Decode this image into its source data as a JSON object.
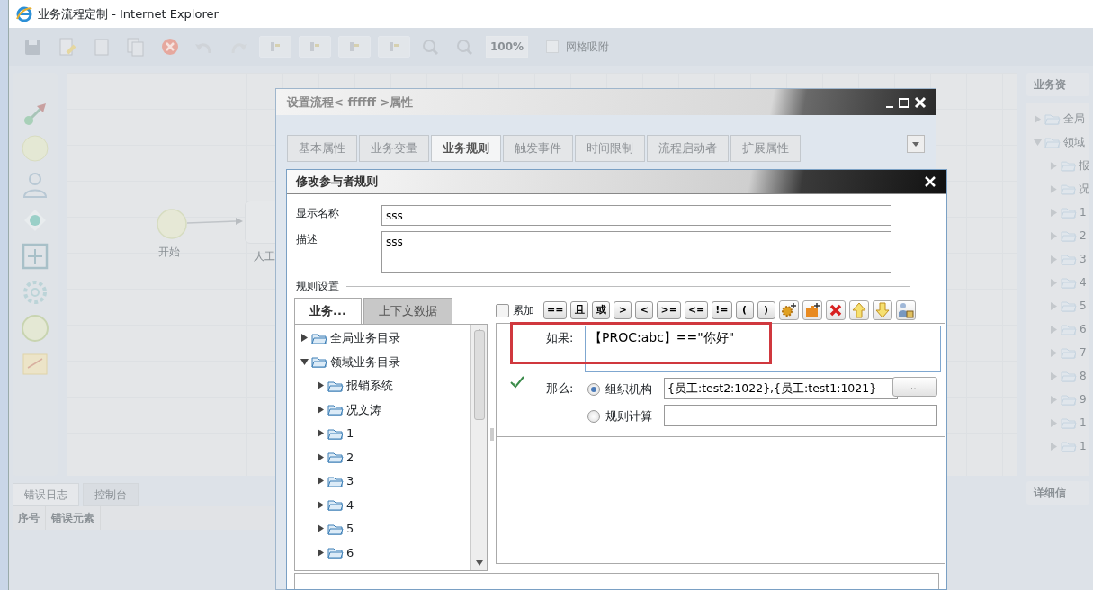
{
  "window": {
    "title": "业务流程定制 - Internet Explorer"
  },
  "toolbar": {
    "zoom": "100%",
    "grid": {
      "label": "网格吸附",
      "checked": false
    }
  },
  "canvas": {
    "nodes": [
      {
        "kind": "start",
        "label": "开始"
      },
      {
        "kind": "task",
        "label": "人工"
      }
    ]
  },
  "bottom_panel": {
    "tabs": [
      {
        "label": "错误日志",
        "selected": true
      },
      {
        "label": "控制台",
        "selected": false
      }
    ],
    "columns": [
      "序号",
      "错误元素"
    ]
  },
  "right_panel": {
    "resource_title": "业务资",
    "tree": [
      {
        "label": "全局",
        "expanded": false
      },
      {
        "label": "领域",
        "expanded": true,
        "children": [
          {
            "label": "报",
            "expanded": false
          },
          {
            "label": "况",
            "expanded": false
          },
          {
            "label": "1",
            "expanded": false
          },
          {
            "label": "2",
            "expanded": false
          },
          {
            "label": "3",
            "expanded": false
          },
          {
            "label": "4",
            "expanded": false
          },
          {
            "label": "5",
            "expanded": false
          },
          {
            "label": "6",
            "expanded": false
          },
          {
            "label": "7",
            "expanded": false
          },
          {
            "label": "8",
            "expanded": false
          },
          {
            "label": "9",
            "expanded": false
          },
          {
            "label": "1",
            "expanded": false
          },
          {
            "label": "1",
            "expanded": false
          }
        ]
      }
    ],
    "detail_title": "详细信"
  },
  "property_dialog": {
    "title": "设置流程< ffffff >属性",
    "tabs": [
      {
        "label": "基本属性",
        "selected": false
      },
      {
        "label": "业务变量",
        "selected": false
      },
      {
        "label": "业务规则",
        "selected": true
      },
      {
        "label": "触发事件",
        "selected": false
      },
      {
        "label": "时间限制",
        "selected": false
      },
      {
        "label": "流程启动者",
        "selected": false
      },
      {
        "label": "扩展属性",
        "selected": false
      }
    ]
  },
  "rule_dialog": {
    "title": "修改参与者规则",
    "display_name": {
      "label": "显示名称",
      "value": "sss"
    },
    "description": {
      "label": "描述",
      "value": "sss"
    },
    "section": "规则设置",
    "source_tabs": [
      {
        "label": "业务...",
        "selected": true
      },
      {
        "label": "上下文数据",
        "selected": false
      }
    ],
    "tree": [
      {
        "label": "全局业务目录",
        "expanded": false
      },
      {
        "label": "领域业务目录",
        "expanded": true,
        "children": [
          {
            "label": "报销系统",
            "expanded": false
          },
          {
            "label": "况文涛",
            "expanded": false
          },
          {
            "label": "1",
            "expanded": false
          },
          {
            "label": "2",
            "expanded": false
          },
          {
            "label": "3",
            "expanded": false
          },
          {
            "label": "4",
            "expanded": false
          },
          {
            "label": "5",
            "expanded": false
          },
          {
            "label": "6",
            "expanded": false
          }
        ]
      }
    ],
    "accumulate": {
      "label": "累加",
      "checked": false
    },
    "operators": [
      "==",
      "且",
      "或",
      ">",
      "<",
      ">=",
      "<=",
      "!=",
      "(",
      ")"
    ],
    "if": {
      "label": "如果:",
      "value": "【PROC:abc】==\"你好\""
    },
    "then": {
      "label": "那么:",
      "options": [
        {
          "label": "组织机构",
          "selected": true,
          "value": "{员工:test2:1022},{员工:test1:1021}"
        },
        {
          "label": "规则计算",
          "selected": false
        }
      ]
    },
    "browse_button": "..."
  }
}
